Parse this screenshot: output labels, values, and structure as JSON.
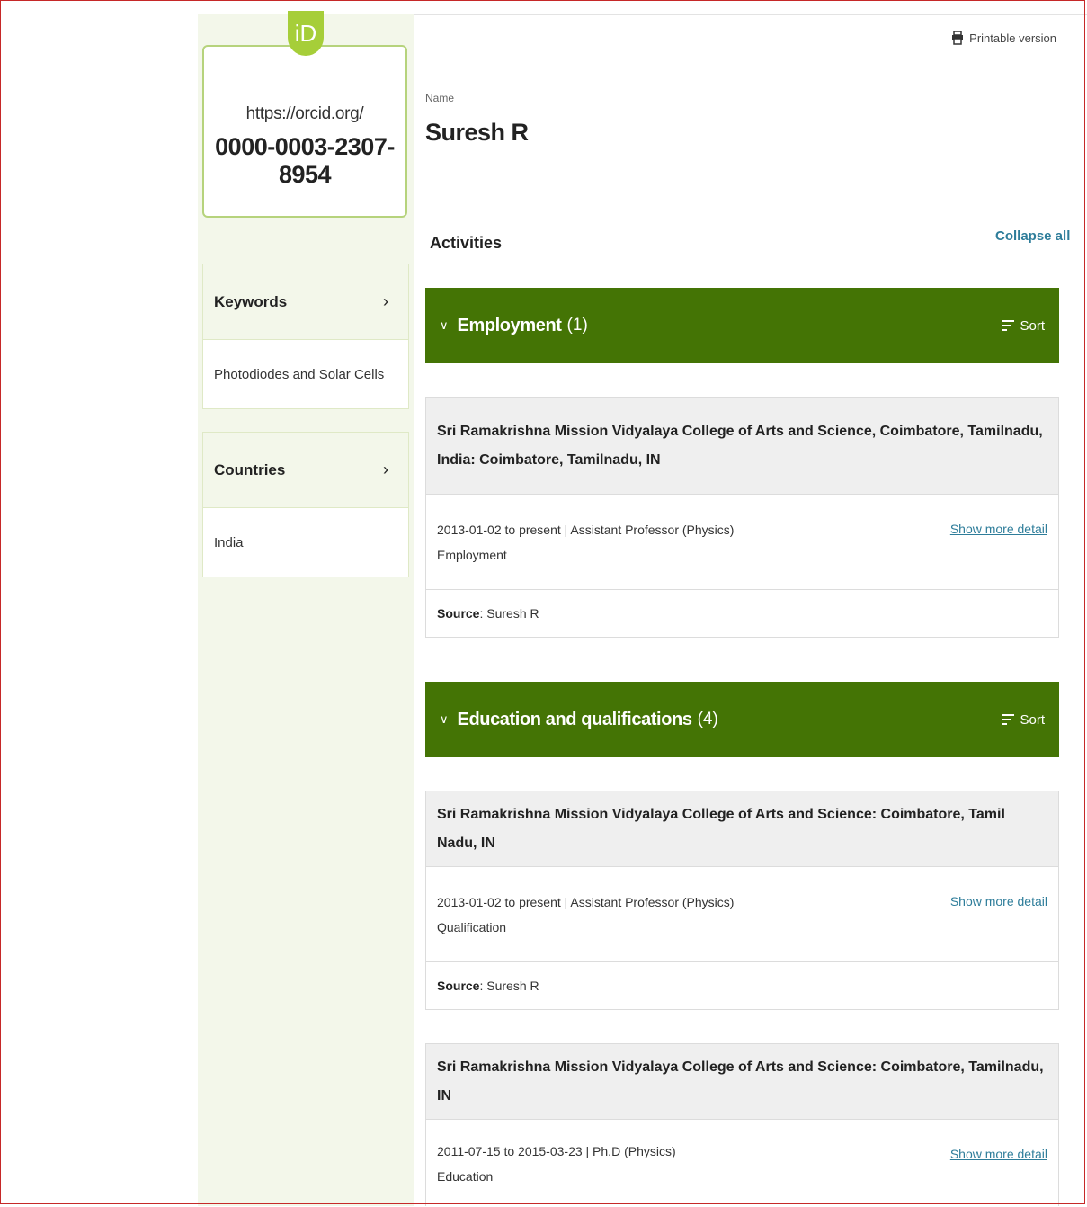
{
  "record": {
    "orcid_prefix": "https://orcid.org/",
    "orcid_id": "0000-0003-2307-8954",
    "logo_text": "iD"
  },
  "sidebar": {
    "keywords": {
      "title": "Keywords",
      "value": "Photodiodes and Solar Cells"
    },
    "countries": {
      "title": "Countries",
      "value": "India"
    }
  },
  "header": {
    "printable_label": "Printable version",
    "name_label": "Name",
    "name_value": "Suresh R"
  },
  "activities": {
    "title": "Activities",
    "collapse_label": "Collapse all"
  },
  "employment": {
    "title": "Employment",
    "count": "(1)",
    "sort_label": "Sort",
    "items": [
      {
        "org": "Sri Ramakrishna Mission Vidyalaya College of Arts and Science, Coimbatore, Tamilnadu, India: Coimbatore, Tamilnadu, IN",
        "dates_role": "2013-01-02 to present | Assistant Professor (Physics)",
        "type": "Employment",
        "more": "Show more detail",
        "source_label": "Source",
        "source_value": ": Suresh R"
      }
    ]
  },
  "education": {
    "title": "Education and qualifications",
    "count": "(4)",
    "sort_label": "Sort",
    "items": [
      {
        "org": "Sri Ramakrishna Mission Vidyalaya College of Arts and Science: Coimbatore, Tamil Nadu, IN",
        "dates_role": "2013-01-02 to present | Assistant Professor (Physics)",
        "type": "Qualification",
        "more": "Show more detail",
        "source_label": "Source",
        "source_value": ": Suresh R"
      },
      {
        "org": "Sri Ramakrishna Mission Vidyalaya College of Arts and Science: Coimbatore, Tamilnadu, IN",
        "dates_role": "2011-07-15 to 2015-03-23 | Ph.D (Physics)",
        "type": "Education",
        "more": "Show more detail"
      }
    ]
  },
  "colors": {
    "section_header": "#447405",
    "sidebar_bg": "#f3f7ea",
    "orcid_green": "#a6ce39",
    "link": "#2e7d9a"
  }
}
